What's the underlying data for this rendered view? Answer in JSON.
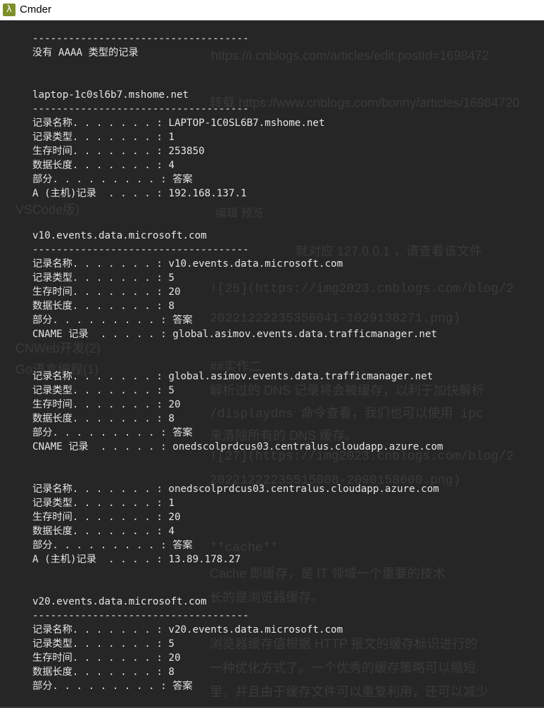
{
  "window": {
    "title": "Cmder",
    "icon": "lambda-icon",
    "icon_glyph": "λ",
    "accent": "#7c8f2a"
  },
  "console": {
    "lines": [
      "------------------------------------",
      "没有 AAAA 类型的记录",
      "",
      "",
      "laptop-1c0sl6b7.mshome.net",
      "------------------------------------",
      "记录名称. . . . . . . : LAPTOP-1C0SL6B7.mshome.net",
      "记录类型. . . . . . . : 1",
      "生存时间. . . . . . . : 253850",
      "数据长度. . . . . . . : 4",
      "部分. . . . . . . . . : 答案",
      "A (主机)记录  . . . . : 192.168.137.1",
      "",
      "",
      "v10.events.data.microsoft.com",
      "------------------------------------",
      "记录名称. . . . . . . : v10.events.data.microsoft.com",
      "记录类型. . . . . . . : 5",
      "生存时间. . . . . . . : 20",
      "数据长度. . . . . . . : 8",
      "部分. . . . . . . . . : 答案",
      "CNAME 记录  . . . . . : global.asimov.events.data.trafficmanager.net",
      "",
      "",
      "记录名称. . . . . . . : global.asimov.events.data.trafficmanager.net",
      "记录类型. . . . . . . : 5",
      "生存时间. . . . . . . : 20",
      "数据长度. . . . . . . : 8",
      "部分. . . . . . . . . : 答案",
      "CNAME 记录  . . . . . : onedscolprdcus03.centralus.cloudapp.azure.com",
      "",
      "",
      "记录名称. . . . . . . : onedscolprdcus03.centralus.cloudapp.azure.com",
      "记录类型. . . . . . . : 1",
      "生存时间. . . . . . . : 20",
      "数据长度. . . . . . . : 4",
      "部分. . . . . . . . . : 答案",
      "A (主机)记录  . . . . : 13.89.178.27",
      "",
      "",
      "v20.events.data.microsoft.com",
      "------------------------------------",
      "记录名称. . . . . . . : v20.events.data.microsoft.com",
      "记录类型. . . . . . . : 5",
      "生存时间. . . . . . . : 20",
      "数据长度. . . . . . . : 8",
      "部分. . . . . . . . . : 答案"
    ]
  },
  "background_ghost": {
    "url": "https://i.cnblogs.com/articles/edit;postId=1698472",
    "reprint": "转载 https://www.cnblogs.com/bonny/articles/16984720",
    "tabs": "编辑   预览",
    "text1": "就对应 127.0.0.1 ，请查看该文件",
    "text2": "![25](https://img2023.cnblogs.com/blog/2",
    "text3": "20221222235358041-1029138271.png)",
    "text4": "##实作二",
    "text5": "解析过的 DNS 记录将会被缓存，以利于加快解析",
    "text6": "/displaydns 命令查看，我们也可以使用 ipc",
    "text7": "来清除所有的 DNS 缓存。",
    "text8": "![27](https://img2023.cnblogs.com/blog/2",
    "text9": "20221222235515008-2090158600.png)",
    "text10": "**cache**",
    "text11": "Cache 即缓存，是 IT 领域一个重要的技术",
    "text12": "长的是浏览器缓存。",
    "text13": "浏览器缓存值根据 HTTP 报文的缓存标识进行的",
    "text14": "一种优化方式了。一个优秀的缓存策略可以缩短",
    "text15": "里，并且由于缓存文件可以重复利用，还可以减少",
    "side1": "VSCode版)",
    "side2": "CNWeb开发(2)",
    "side3": "Go语言编程(1)"
  }
}
